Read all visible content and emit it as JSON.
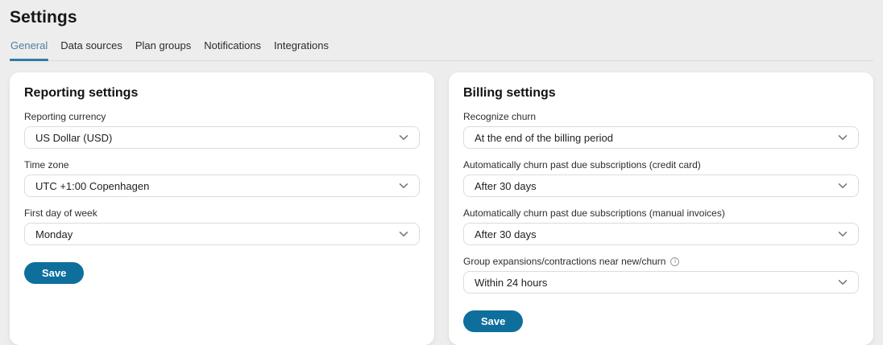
{
  "page": {
    "title": "Settings"
  },
  "tabs": [
    {
      "label": "General",
      "active": true
    },
    {
      "label": "Data sources",
      "active": false
    },
    {
      "label": "Plan groups",
      "active": false
    },
    {
      "label": "Notifications",
      "active": false
    },
    {
      "label": "Integrations",
      "active": false
    }
  ],
  "reporting": {
    "title": "Reporting settings",
    "fields": [
      {
        "label": "Reporting currency",
        "value": "US Dollar (USD)"
      },
      {
        "label": "Time zone",
        "value": "UTC +1:00 Copenhagen"
      },
      {
        "label": "First day of week",
        "value": "Monday"
      }
    ],
    "save_label": "Save"
  },
  "billing": {
    "title": "Billing settings",
    "fields": [
      {
        "label": "Recognize churn",
        "value": "At the end of the billing period"
      },
      {
        "label": "Automatically churn past due subscriptions (credit card)",
        "value": "After 30 days"
      },
      {
        "label": "Automatically churn past due subscriptions (manual invoices)",
        "value": "After 30 days"
      },
      {
        "label": "Group expansions/contractions near new/churn",
        "value": "Within 24 hours",
        "has_info_icon": true
      }
    ],
    "save_label": "Save"
  },
  "icons": {
    "info": "i",
    "chevron_down": "chevron-down"
  },
  "colors": {
    "accent": "#0e6f9d",
    "tab_active_text": "#4f7f9e",
    "tab_underline": "#2e7ca4",
    "page_background": "#ededed",
    "card_background": "#ffffff",
    "border": "#dcdcdc",
    "text": "#1f1f1f",
    "label": "#2d2d2d",
    "divider": "#d9d9d9"
  }
}
